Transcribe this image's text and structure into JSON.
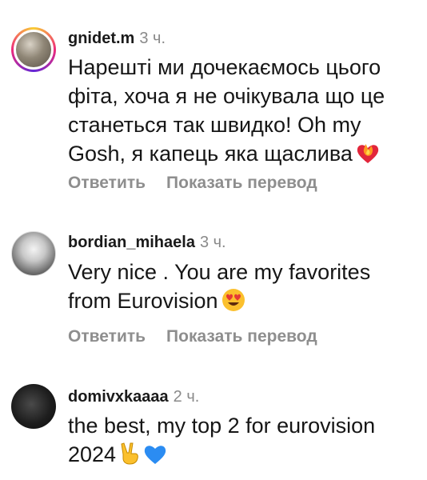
{
  "comments": [
    {
      "username": "gnidet.m",
      "time": "3 ч.",
      "text": "Нарешті ми дочекаємось цього фіта, хоча я не очікувала що це станеться так швидко! Oh my Gosh, я капець яка щаслива",
      "emoji": [
        "heart-on-fire-icon"
      ],
      "reply": "Ответить",
      "translate": "Показать перевод"
    },
    {
      "username": "bordian_mihaela",
      "time": "3 ч.",
      "text": "Very nice . You are my favorites from Eurovision",
      "emoji": [
        "heart-eyes-icon"
      ],
      "reply": "Ответить",
      "translate": "Показать перевод"
    },
    {
      "username": "domivxkaaaa",
      "time": "2 ч.",
      "text": "the best, my top 2 for eurovision 2024",
      "emoji": [
        "victory-hand-icon",
        "blue-heart-icon"
      ]
    }
  ],
  "colors": {
    "username": "#1a1a1a",
    "meta": "#8e8e8e",
    "story_ring": [
      "#f9ce34",
      "#ee2a7b",
      "#6228d7"
    ],
    "blue_heart": "#2b8cf2"
  }
}
